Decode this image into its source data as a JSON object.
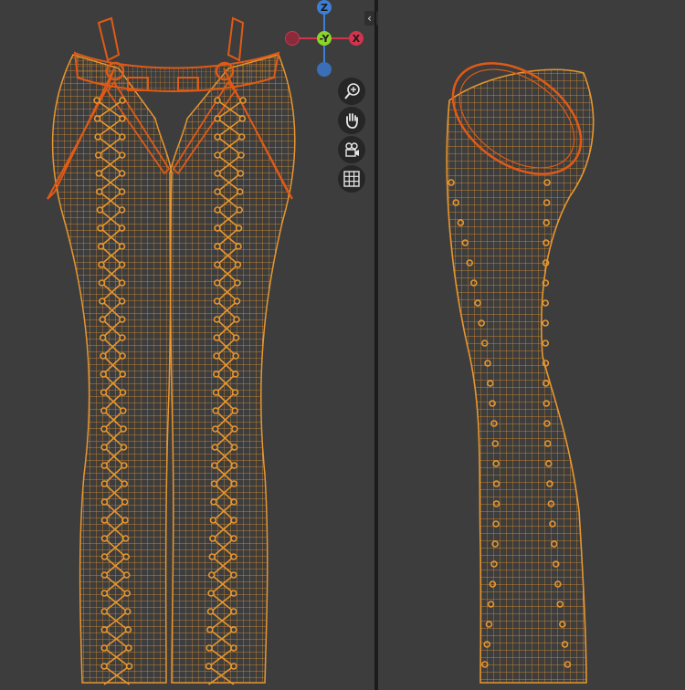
{
  "app": {
    "title": "",
    "accent_mesh": "#e8962e",
    "accent_mesh_selected": "#e05a16",
    "background": "#3d3d3d"
  },
  "views": [
    {
      "name": "front",
      "label": ""
    },
    {
      "name": "side",
      "label": ""
    }
  ],
  "split_arrows": {
    "left": "‹",
    "right": "›"
  },
  "gizmo": {
    "z_label": "Z",
    "y_label": "-Y",
    "x_label": "X",
    "colors": {
      "x": "#d2344e",
      "y": "#8bd42a",
      "z": "#3d7ed8"
    }
  },
  "nav_tools": [
    {
      "name": "zoom",
      "icon": "zoom-icon"
    },
    {
      "name": "pan",
      "icon": "hand-icon"
    },
    {
      "name": "camera",
      "icon": "camera-icon"
    },
    {
      "name": "perspective",
      "icon": "grid-icon"
    }
  ]
}
